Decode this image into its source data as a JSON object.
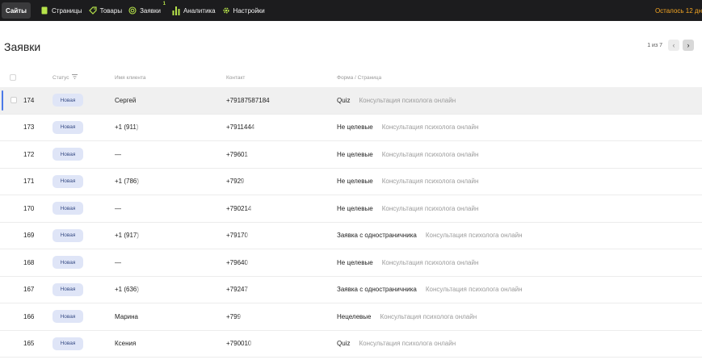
{
  "nav": {
    "sites_label": "Сайты",
    "items": [
      {
        "label": "Страницы",
        "icon": "page-icon"
      },
      {
        "label": "Товары",
        "icon": "tag-icon"
      },
      {
        "label": "Заявки",
        "icon": "target-icon",
        "badge": "1"
      },
      {
        "label": "Аналитика",
        "icon": "bar-chart-icon"
      },
      {
        "label": "Настройки",
        "icon": "gear-icon"
      }
    ],
    "trial_text": "Осталось 12 дн",
    "accent_green": "#b6e34a",
    "accent_orange": "#f5a623"
  },
  "header": {
    "title": "Заявки",
    "pagination": "1 из 7"
  },
  "table": {
    "columns": {
      "status": "Статус",
      "client": "Имя клиента",
      "contact": "Контакт",
      "form": "Форма / Страница"
    },
    "rows": [
      {
        "id": "174",
        "status": "Новая",
        "client": "Сергей",
        "contact": "+79187587184",
        "form": "Quiz",
        "page": "Консультация психолога онлайн"
      },
      {
        "id": "173",
        "status": "Новая",
        "client": "+1 (911)",
        "contact": "+7911444",
        "form": "Не целевые",
        "page": "Консультация психолога онлайн"
      },
      {
        "id": "172",
        "status": "Новая",
        "client": "—",
        "contact": "+79601",
        "form": "Не целевые",
        "page": "Консультация психолога онлайн"
      },
      {
        "id": "171",
        "status": "Новая",
        "client": "+1 (786)",
        "contact": "+7929",
        "form": "Не целевые",
        "page": "Консультация психолога онлайн"
      },
      {
        "id": "170",
        "status": "Новая",
        "client": "—",
        "contact": "+790214",
        "form": "Не целевые",
        "page": "Консультация психолога онлайн"
      },
      {
        "id": "169",
        "status": "Новая",
        "client": "+1 (917)",
        "contact": "+79170",
        "form": "Заявка с одностраничника",
        "page": "Консультация психолога онлайн"
      },
      {
        "id": "168",
        "status": "Новая",
        "client": "—",
        "contact": "+79640",
        "form": "Не целевые",
        "page": "Консультация психолога онлайн"
      },
      {
        "id": "167",
        "status": "Новая",
        "client": "+1 (636)",
        "contact": "+79247",
        "form": "Заявка с одностраничника",
        "page": "Консультация психолога онлайн"
      },
      {
        "id": "166",
        "status": "Новая",
        "client": "Марина",
        "contact": "+799",
        "form": "Нецелевые",
        "page": "Консультация психолога онлайн"
      },
      {
        "id": "165",
        "status": "Новая",
        "client": "Ксения",
        "contact": "+790010",
        "form": "Quiz",
        "page": "Консультация психолога онлайн"
      }
    ]
  }
}
